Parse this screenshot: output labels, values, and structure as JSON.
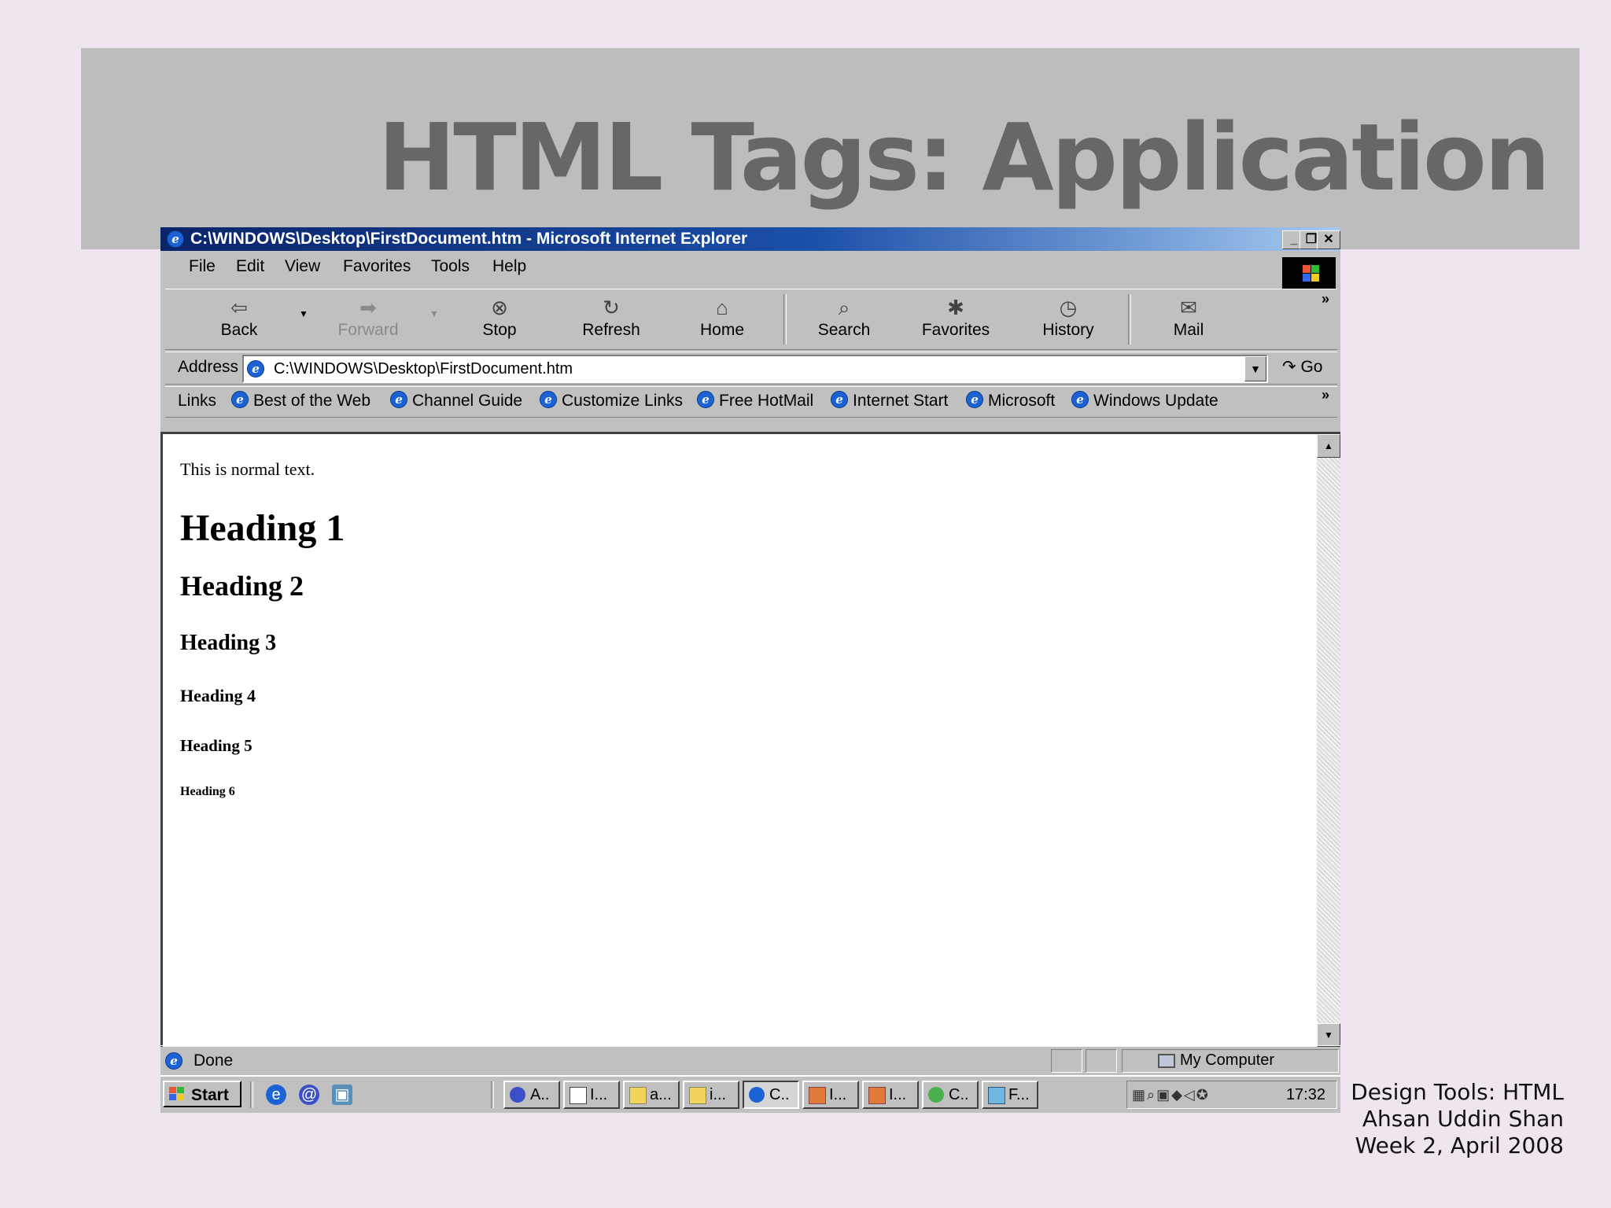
{
  "slide": {
    "title": "HTML Tags: Application",
    "footer": [
      "Design Tools: HTML",
      "Ahsan Uddin Shan",
      "Week 2, April 2008"
    ]
  },
  "window": {
    "title": "C:\\WINDOWS\\Desktop\\FirstDocument.htm - Microsoft Internet Explorer",
    "controls": {
      "minimize": "_",
      "restore": "❐",
      "close": "✕"
    }
  },
  "menu": [
    "File",
    "Edit",
    "View",
    "Favorites",
    "Tools",
    "Help"
  ],
  "toolbar": {
    "back": "Back",
    "forward": "Forward",
    "stop": "Stop",
    "refresh": "Refresh",
    "home": "Home",
    "search": "Search",
    "favorites": "Favorites",
    "history": "History",
    "mail": "Mail",
    "more": "»"
  },
  "address": {
    "label": "Address",
    "value": "C:\\WINDOWS\\Desktop\\FirstDocument.htm",
    "go": "Go"
  },
  "links": {
    "label": "Links",
    "items": [
      "Best of the Web",
      "Channel Guide",
      "Customize Links",
      "Free HotMail",
      "Internet Start",
      "Microsoft",
      "Windows Update"
    ],
    "more": "»"
  },
  "document": {
    "p": "This is normal text.",
    "h1": "Heading 1",
    "h2": "Heading 2",
    "h3": "Heading 3",
    "h4": "Heading 4",
    "h5": "Heading 5",
    "h6": "Heading 6"
  },
  "status": {
    "text": "Done",
    "zone": "My Computer"
  },
  "taskbar": {
    "start": "Start",
    "tasks": [
      "A..",
      "I...",
      "a...",
      "i...",
      "C..",
      "I...",
      "I...",
      "C..",
      "F..."
    ],
    "clock": "17:32"
  },
  "colors": {
    "titlebar_start": "#0a246a",
    "titlebar_end": "#a6caf0",
    "chrome": "#c0c0c0",
    "slide_bg": "#efe5ee",
    "title_band": "#bdbdbd",
    "title_text": "#676767"
  }
}
